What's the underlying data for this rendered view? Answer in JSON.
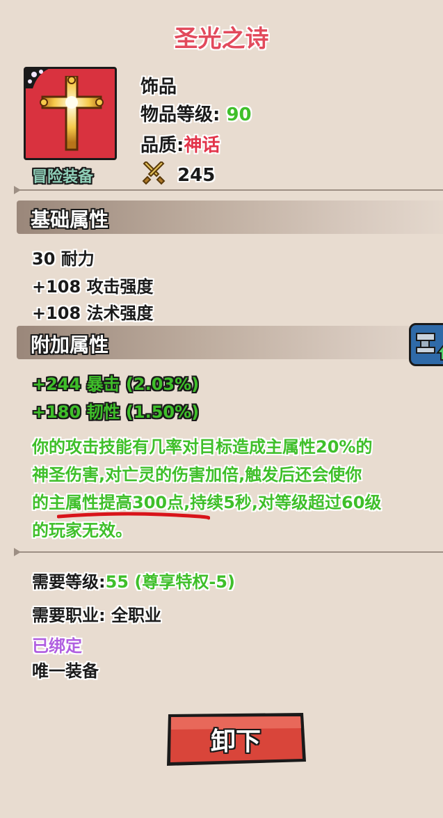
{
  "item": {
    "name": "圣光之诗",
    "slot": "饰品",
    "item_level_label": "物品等级:",
    "item_level_value": "90",
    "quality_label": "品质:",
    "quality_value": "神话",
    "power_value": "245",
    "tag": "冒险装备"
  },
  "sections": {
    "base_title": "基础属性",
    "base_stats": [
      "30 耐力",
      "+108 攻击强度",
      "+108 法术强度"
    ],
    "extra_title": "附加属性",
    "extra_stats": [
      "+244 暴击 (2.03%)",
      "+180 韧性 (1.50%)"
    ],
    "description_lines": [
      "你的攻击技能有几率对目标造成主属性20%的",
      "神圣伤害,对亡灵的伤害加倍,触发后还会使你",
      "的主属性提高300点,持续5秒,对等级超过60级",
      "的玩家无效。"
    ]
  },
  "requirements": {
    "level_label": "需要等级:",
    "level_value": "55 (尊享特权-5)",
    "class_line": "需要职业: 全职业",
    "bound": "已绑定",
    "unique": "唯一装备"
  },
  "actions": {
    "unequip": "卸下"
  },
  "colors": {
    "background": "#e8dcd0",
    "title": "#e24a5c",
    "green": "#3fbf2a",
    "mythic": "#e2344a",
    "bound": "#b05ee0"
  }
}
